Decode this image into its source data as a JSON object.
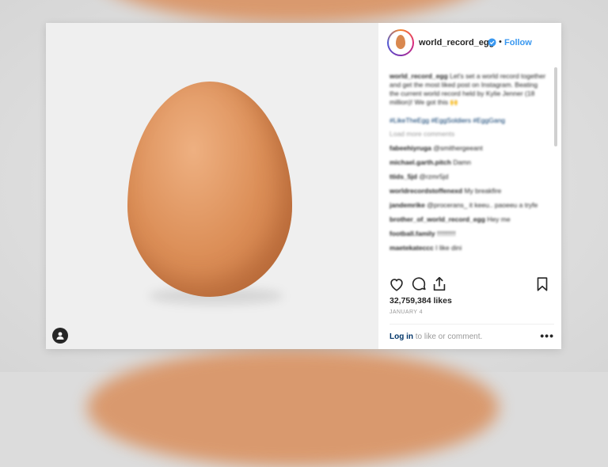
{
  "post": {
    "username": "world_record_egg",
    "separator": "•",
    "follow_label": "Follow",
    "likes": "32,759,384 likes",
    "date": "JANUARY 4",
    "login_link": "Log in",
    "login_rest": " to like or comment.",
    "more_label": "•••"
  },
  "comments": {
    "caption_user": "world_record_egg",
    "caption": "Let's set a world record together and get the most liked post on Instagram. Beating the current world record held by Kylie Jenner (18 million)! We got this 🙌",
    "hashtags": "#LikeTheEgg #EggSoldiers #EggGang",
    "load_more": "Load more comments",
    "items": [
      {
        "user": "fabeehiyruga",
        "text": "@smithergeeant"
      },
      {
        "user": "michael.garth.pitch",
        "text": "Damn"
      },
      {
        "user": "ttids_5jd",
        "text": "@rzmr5jd"
      },
      {
        "user": "worldrecordstoffenexd",
        "text": "My breakfire"
      },
      {
        "user": "jandemrike",
        "text": "@procerans_ it keeu.. paoeeu a tryfe"
      },
      {
        "user": "brother_of_world_record_egg",
        "text": "Hey me"
      },
      {
        "user": "football.family",
        "text": "!!!!!!!!!!"
      },
      {
        "user": "maetekateccc",
        "text": "I like dini"
      }
    ]
  },
  "colors": {
    "accent": "#3897f0",
    "egg": "#dc8f58",
    "text": "#262626"
  },
  "icons": [
    "heart-icon",
    "comment-icon",
    "share-icon",
    "bookmark-icon",
    "user-tag-icon",
    "verified-icon"
  ]
}
